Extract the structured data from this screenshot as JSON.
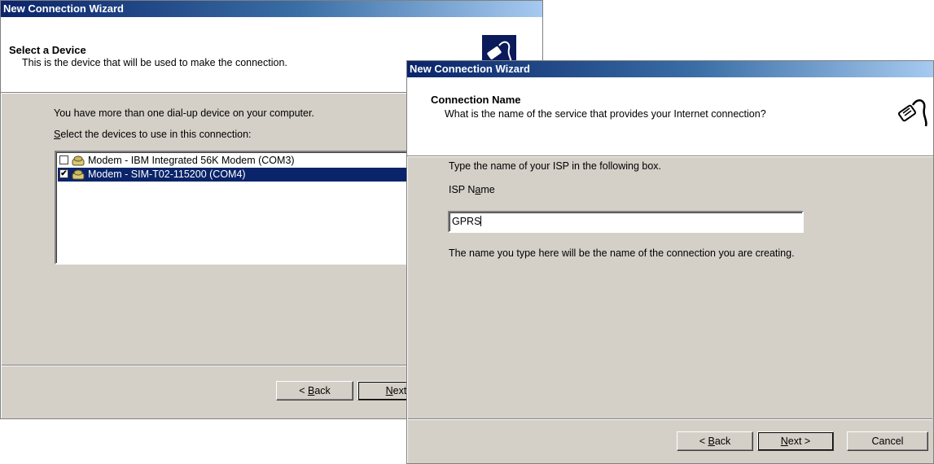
{
  "back_dialog": {
    "title": "New Connection Wizard",
    "header_title": "Select a Device",
    "header_subtitle": "This is the device that will be used to make the connection.",
    "intro_text": "You have more than one dial-up device on your computer.",
    "select_label_accel": "S",
    "select_label_rest": "elect the devices to use in this connection:",
    "devices": [
      {
        "label": "Modem - IBM Integrated 56K Modem (COM3)",
        "checked": false,
        "selected": false
      },
      {
        "label": "Modem - SIM-T02-115200 (COM4)",
        "checked": true,
        "selected": true
      }
    ],
    "back_button": {
      "pre": "< ",
      "accel": "B",
      "rest": "ack"
    },
    "next_button": {
      "accel": "N",
      "rest": "ext"
    }
  },
  "front_dialog": {
    "title": "New Connection Wizard",
    "header_title": "Connection Name",
    "header_subtitle": "What is the name of the service that provides your Internet connection?",
    "instruction": "Type the name of your ISP in the following box.",
    "isp_label_pre": "ISP N",
    "isp_label_accel": "a",
    "isp_label_post": "me",
    "isp_value": "GPRS",
    "hint": "The name you type here will be the name of the connection you are creating.",
    "back_button": {
      "pre": "< ",
      "accel": "B",
      "rest": "ack"
    },
    "next_button": {
      "accel": "N",
      "rest": "ext >"
    },
    "cancel_label": "Cancel"
  },
  "colors": {
    "title_start": "#0a246a",
    "title_end": "#a6caf0",
    "face": "#d4d0c8",
    "selection": "#0a246a"
  },
  "icons": {
    "wizard_logo": "modem-plug-icon",
    "device": "modem-icon"
  }
}
